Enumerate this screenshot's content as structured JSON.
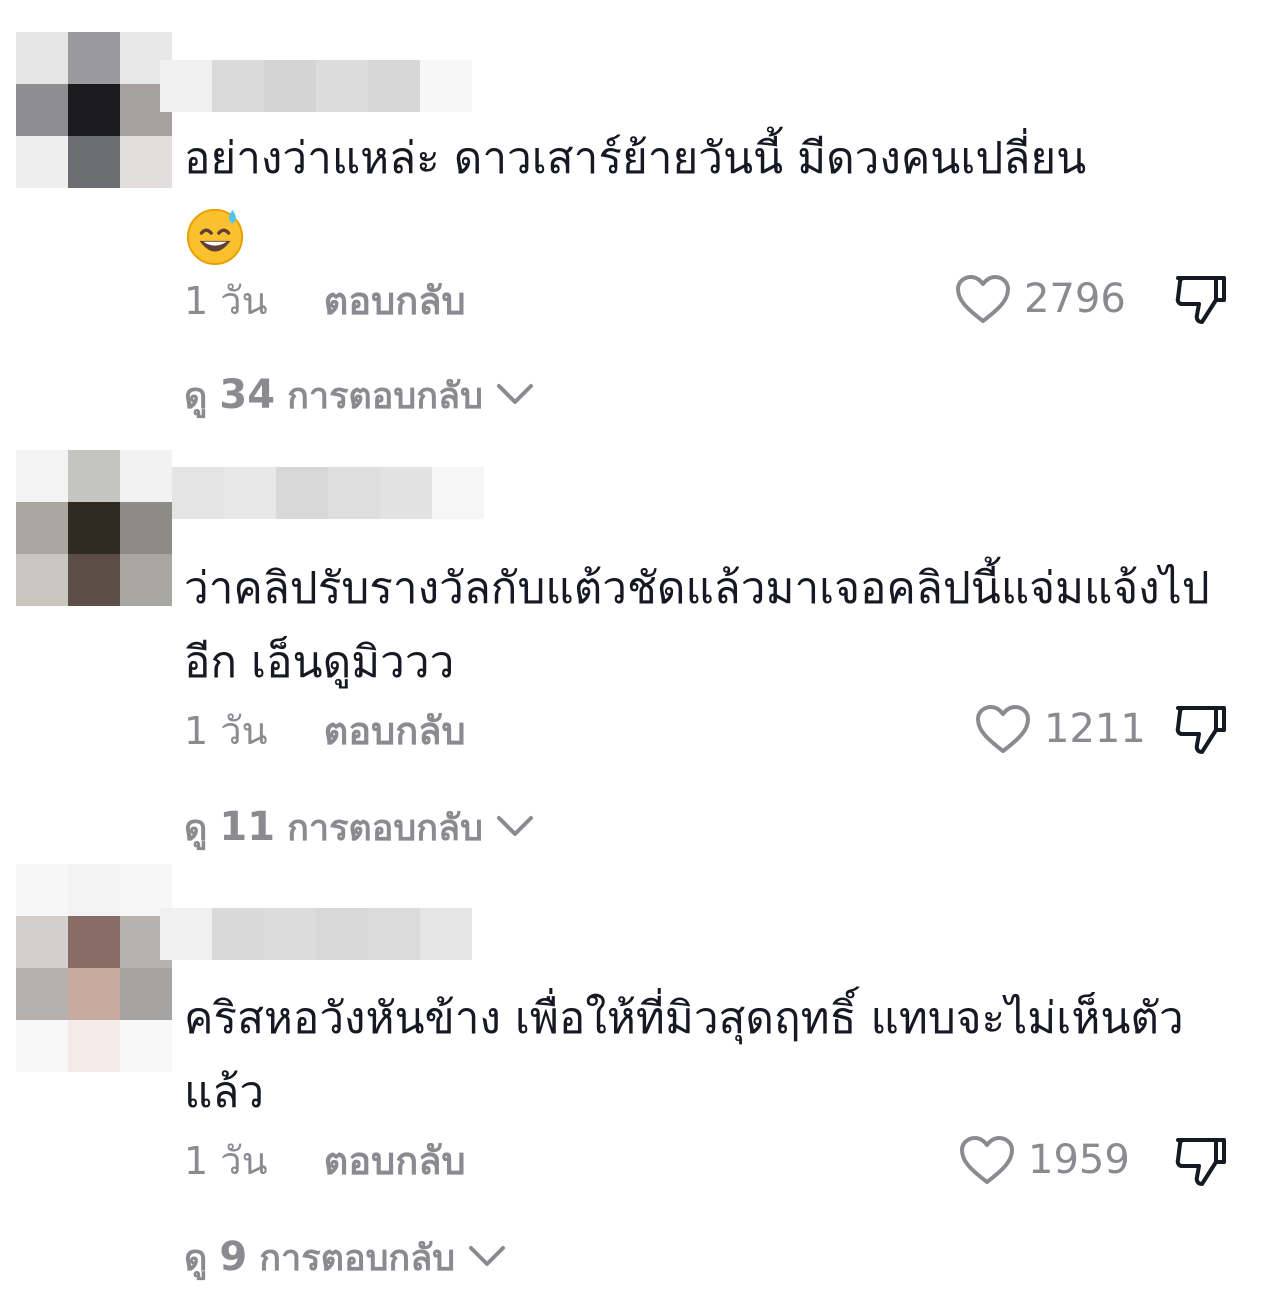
{
  "comments": [
    {
      "text": "อย่างว่าแหล่ะ ดาวเสาร์ย้ายวันนี้ มีดวงคนเปลี่ยน",
      "time": "1 วัน",
      "reply_label": "ตอบกลับ",
      "likes": "2796",
      "view_prefix": "ดู",
      "reply_count": "34",
      "view_suffix": "การตอบกลับ",
      "emoji": "sweat-smile-emoji"
    },
    {
      "text": "ว่าคลิปรับรางวัลกับแต้วชัดแล้วมาเจอคลิปนี้แจ่มแจ้งไปอีก เอ็นดูมิววว",
      "time": "1 วัน",
      "reply_label": "ตอบกลับ",
      "likes": "1211",
      "view_prefix": "ดู",
      "reply_count": "11",
      "view_suffix": "การตอบกลับ"
    },
    {
      "text": "คริสหอวังหันข้าง เพื่อให้ที่มิวสุดฤทธิ์ แทบจะไม่เห็นตัวแล้ว",
      "time": "1 วัน",
      "reply_label": "ตอบกลับ",
      "likes": "1959",
      "view_prefix": "ดู",
      "reply_count": "9",
      "view_suffix": "การตอบกลับ"
    }
  ],
  "icons": {
    "like": "heart-icon",
    "dislike": "thumbs-down-icon",
    "expand": "chevron-down-icon"
  },
  "colors": {
    "text": "#161823",
    "secondary": "#8a8b91"
  }
}
